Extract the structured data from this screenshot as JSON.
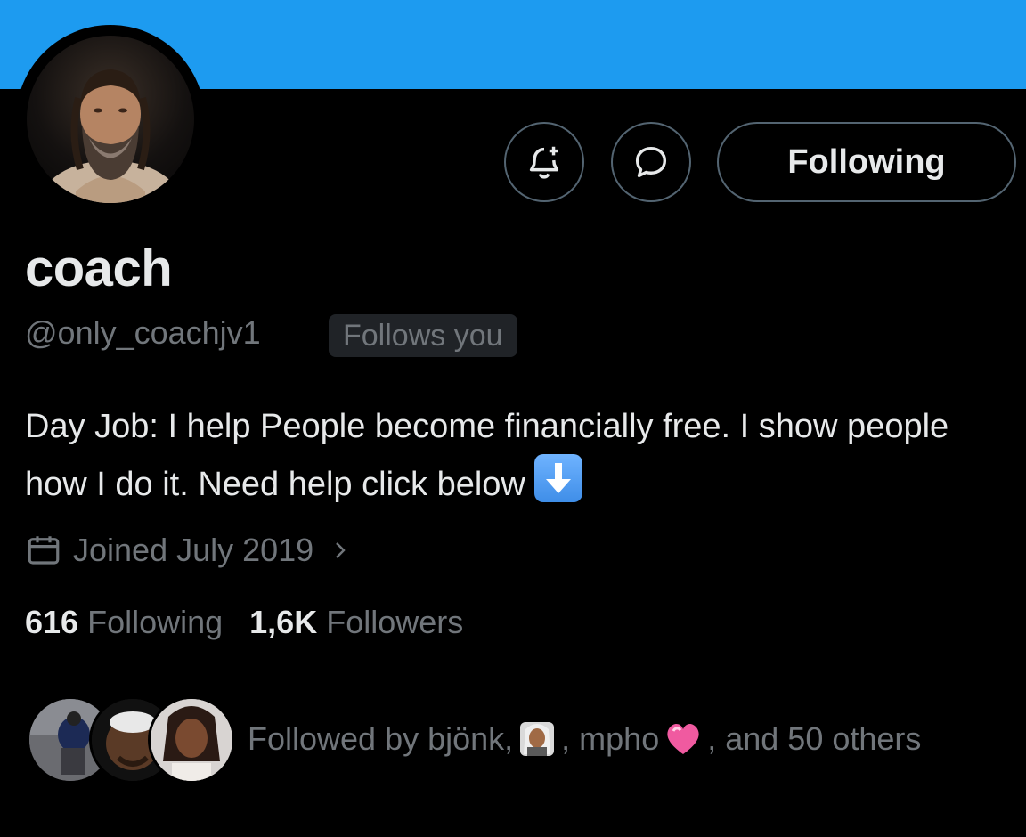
{
  "colors": {
    "banner": "#1d9bf0",
    "background": "#000000",
    "primary_text": "#e7e9ea",
    "secondary_text": "#71767b",
    "border": "#536471"
  },
  "header": {
    "notify_icon": "bell-plus-icon",
    "message_icon": "chat-bubble-icon",
    "follow_button_label": "Following"
  },
  "profile": {
    "name": "coach",
    "handle": "@only_coachjv1",
    "follows_you_badge": "Follows you",
    "bio": "Day Job: I help People become financially free. I show people how I do it. Need help click below",
    "bio_emoji": "down-arrow-emoji",
    "joined": "Joined July 2019",
    "following_count": "616",
    "following_label": "Following",
    "followers_count": "1,6K",
    "followers_label": "Followers"
  },
  "followed_by": {
    "prefix": "Followed by bjönk,",
    "middle": ", mpho",
    "suffix": ", and 50 others",
    "emojis": [
      "person-emoji",
      "pink-heart-emoji"
    ]
  }
}
